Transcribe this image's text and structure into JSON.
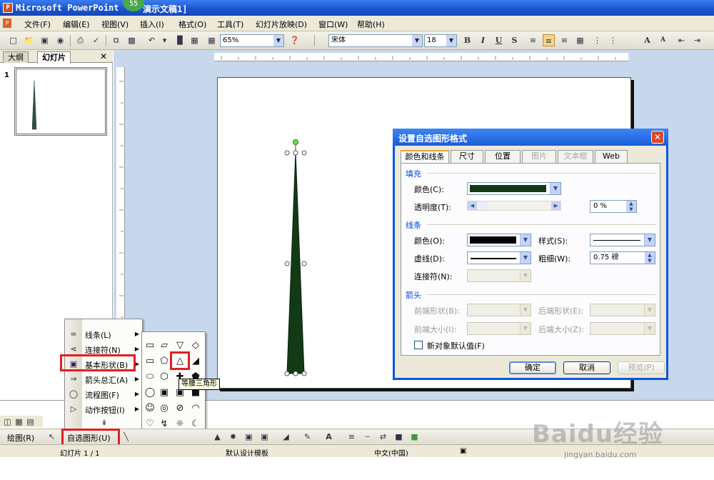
{
  "window": {
    "title": "Microsoft PowerPoint",
    "document": "演示文稿1]",
    "badge": "55"
  },
  "menu": [
    "文件(F)",
    "编辑(E)",
    "视图(V)",
    "插入(I)",
    "格式(O)",
    "工具(T)",
    "幻灯片放映(D)",
    "窗口(W)",
    "帮助(H)"
  ],
  "toolbar": {
    "zoom": "65%",
    "font": "宋体",
    "font_size": "18",
    "bold": "B",
    "italic": "I",
    "underline": "U",
    "shadow": "S"
  },
  "left_pane": {
    "tabs": [
      "大纲",
      "幻灯片"
    ],
    "active_tab": "幻灯片",
    "slide_number": "1"
  },
  "dialog": {
    "title": "设置自选图形格式",
    "tabs": [
      "颜色和线条",
      "尺寸",
      "位置",
      "图片",
      "文本框",
      "Web"
    ],
    "fill_group": "填充",
    "fill_color_label": "颜色(C):",
    "fill_color": "#123a16",
    "transparency_label": "透明度(T):",
    "transparency_value": "0 %",
    "line_group": "线条",
    "line_color_label": "颜色(O):",
    "line_color": "#000000",
    "style_label": "样式(S):",
    "dash_label": "虚线(D):",
    "weight_label": "粗细(W):",
    "weight_value": "0.75 磅",
    "connector_label": "连接符(N):",
    "arrow_group": "箭头",
    "begin_style_label": "前端形状(B):",
    "end_style_label": "后端形状(E):",
    "begin_size_label": "前端大小(I):",
    "end_size_label": "后端大小(Z):",
    "default_checkbox": "新对象默认值(F)",
    "ok": "确定",
    "cancel": "取消",
    "preview": "预览(P)"
  },
  "autoshape_menu": {
    "items": [
      "线条(L)",
      "连接符(N)",
      "基本形状(B)",
      "箭头总汇(A)",
      "流程图(F)",
      "动作按钮(I)"
    ],
    "highlighted": "基本形状(B)"
  },
  "shape_tooltip": "等腰三角形",
  "draw_toolbar": {
    "draw": "绘图(R)",
    "autoshapes": "自选图形(U)"
  },
  "status": {
    "slide": "幻灯片 1 / 1",
    "template": "默认设计模板",
    "language": "中文(中国)"
  },
  "watermark": {
    "brand": "Baidu经验",
    "url": "jingyan.baidu.com"
  },
  "colors": {
    "tree_fill": "#123a16",
    "highlight_red": "#e02020",
    "xp_blue": "#0a55e0"
  }
}
